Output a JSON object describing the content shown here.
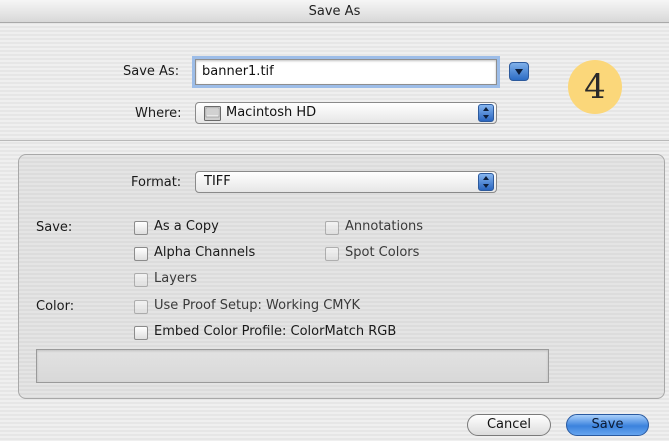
{
  "window": {
    "title": "Save As"
  },
  "top": {
    "save_as_label": "Save As:",
    "filename": "banner1.tif",
    "where_label": "Where:",
    "where_value": "Macintosh HD"
  },
  "step_badge": "4",
  "options": {
    "format_label": "Format:",
    "format_value": "TIFF",
    "save_label": "Save:",
    "save_checkboxes": [
      {
        "label": "As a Copy",
        "checked": false,
        "enabled": true
      },
      {
        "label": "Alpha Channels",
        "checked": false,
        "enabled": true
      },
      {
        "label": "Layers",
        "checked": false,
        "enabled": false
      },
      {
        "label": "Annotations",
        "checked": false,
        "enabled": false
      },
      {
        "label": "Spot Colors",
        "checked": false,
        "enabled": false
      }
    ],
    "color_label": "Color:",
    "color_checkboxes": [
      {
        "label": "Use Proof Setup:  Working CMYK",
        "checked": false,
        "enabled": false
      },
      {
        "label": "Embed Color Profile:  ColorMatch RGB",
        "checked": false,
        "enabled": true
      }
    ]
  },
  "buttons": {
    "cancel": "Cancel",
    "save": "Save"
  },
  "colors": {
    "accent": "#3b82dd",
    "badge": "#fbd77a",
    "focus_ring": "#9dbde8"
  }
}
